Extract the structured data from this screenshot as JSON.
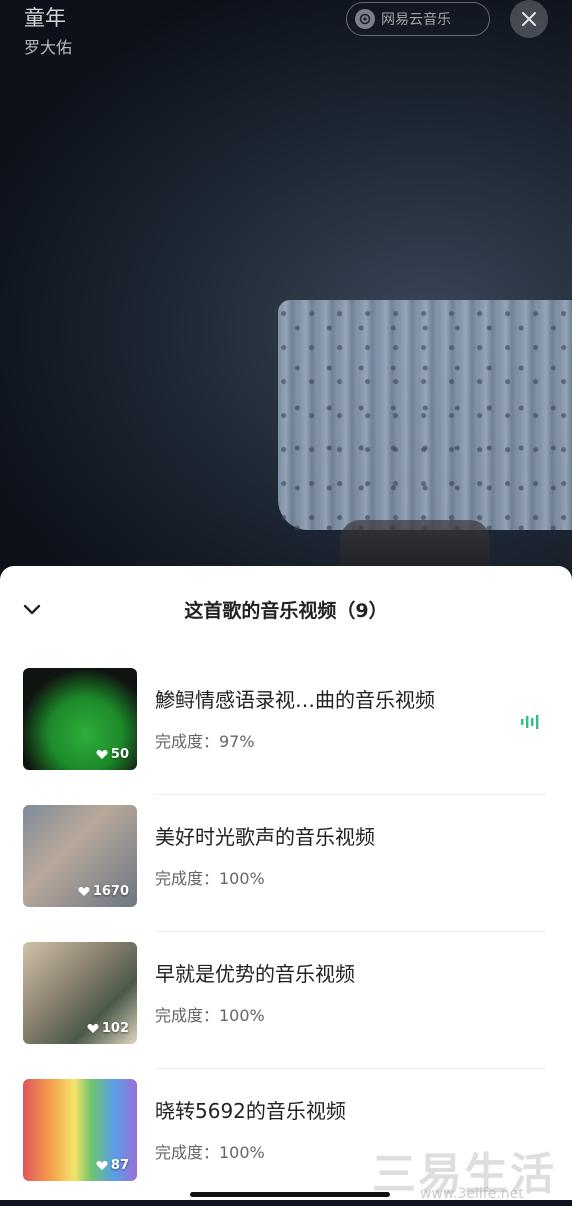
{
  "video": {
    "song_title": "童年",
    "artist": "罗大佑",
    "brand_label": "网易云音乐"
  },
  "sheet": {
    "title": "这首歌的音乐视频（9）",
    "items": [
      {
        "title": "鯵鲟情感语录视…曲的音乐视频",
        "progress": "完成度：97%",
        "likes": "50",
        "playing": true
      },
      {
        "title": "美好时光歌声的音乐视频",
        "progress": "完成度：100%",
        "likes": "1670",
        "playing": false
      },
      {
        "title": "早就是优势的音乐视频",
        "progress": "完成度：100%",
        "likes": "102",
        "playing": false
      },
      {
        "title": "晓转5692的音乐视频",
        "progress": "完成度：100%",
        "likes": "87",
        "playing": false
      }
    ]
  },
  "watermark": {
    "text": "三易生活",
    "url": "www.3elife.net"
  },
  "colors": {
    "accent_green": "#2ec27e",
    "sheet_bg": "#ffffff"
  }
}
